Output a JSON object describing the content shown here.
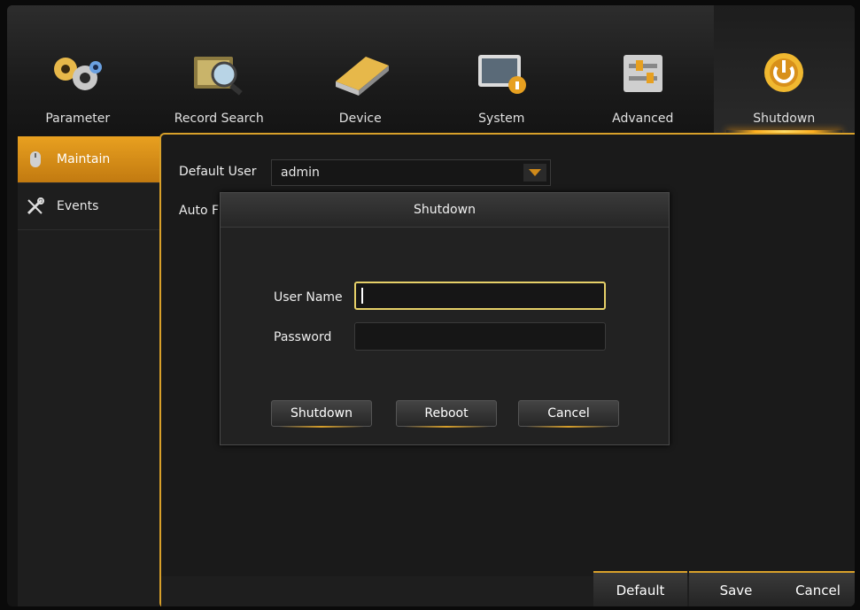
{
  "tabs": [
    {
      "label": "Parameter",
      "icon": "gears-icon"
    },
    {
      "label": "Record Search",
      "icon": "film-search-icon"
    },
    {
      "label": "Device",
      "icon": "hard-drive-icon"
    },
    {
      "label": "System",
      "icon": "system-info-icon"
    },
    {
      "label": "Advanced",
      "icon": "sliders-icon"
    },
    {
      "label": "Shutdown",
      "icon": "power-icon"
    }
  ],
  "sidebar": {
    "items": [
      {
        "label": "Maintain",
        "icon": "mouse-icon"
      },
      {
        "label": "Events",
        "icon": "tools-icon"
      }
    ]
  },
  "main": {
    "default_user_label": "Default User",
    "default_user_value": "admin",
    "auto_label": "Auto F"
  },
  "dialog": {
    "title": "Shutdown",
    "username_label": "User Name",
    "username_value": "",
    "password_label": "Password",
    "password_value": "",
    "buttons": {
      "shutdown": "Shutdown",
      "reboot": "Reboot",
      "cancel": "Cancel"
    }
  },
  "bottom": {
    "default": "Default",
    "save": "Save",
    "cancel": "Cancel"
  },
  "colors": {
    "accent": "#d8a02a",
    "active_tab_glow": "#ffb020",
    "background": "#141414"
  }
}
